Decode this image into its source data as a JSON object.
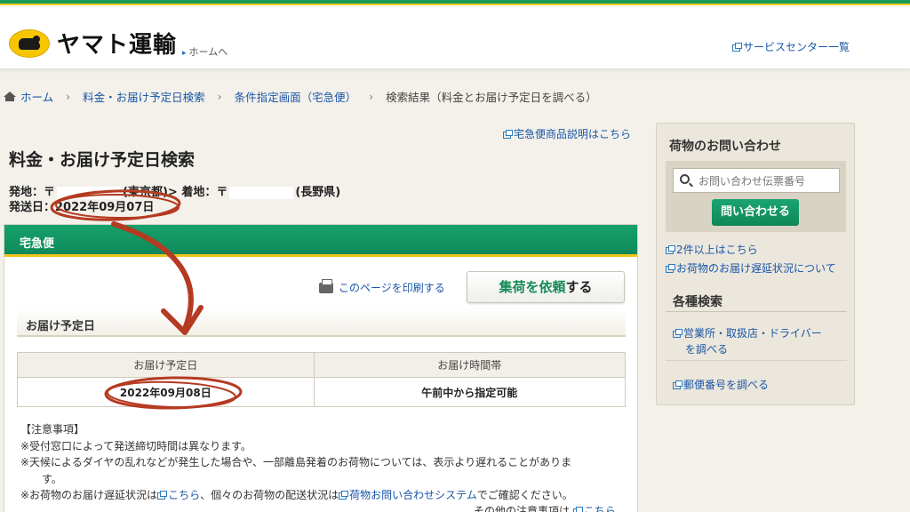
{
  "header": {
    "brand": "ヤマト運輸",
    "home_link": "ホームへ",
    "service_link": "サービスセンター一覧"
  },
  "breadcrumb": {
    "home": "ホーム",
    "item1": "料金・お届け予定日検索",
    "item2": "条件指定画面（宅急便）",
    "current": "検索結果（料金とお届け予定日を調べる）"
  },
  "main": {
    "product_link": "宅急便商品説明はこちら",
    "title": "料金・お届け予定日検索",
    "origin_label": "発地：〒",
    "origin_pref": "(東京都)",
    "dest_label": "> 着地：〒",
    "dest_pref": "(長野県)",
    "ship_date_label": "発送日：",
    "ship_date": "2022年09月07日"
  },
  "card": {
    "header": "宅急便",
    "print_link": "このページを印刷する",
    "pickup_button_hl": "集荷を依頼",
    "pickup_button_rest": "する",
    "section_title": "お届け予定日",
    "table": {
      "col1": "お届け予定日",
      "col2": "お届け時間帯",
      "val1": "2022年09月08日",
      "val2": "午前中から指定可能"
    },
    "notes_title": "【注意事項】",
    "note1": "※受付窓口によって発送締切時間は異なります。",
    "note2": "※天候によるダイヤの乱れなどが発生した場合や、一部離島発着のお荷物については、表示より遅れることがありま",
    "note2b": "す。",
    "note3a": "※お荷物のお届け遅延状況は",
    "note3_link1": "こちら",
    "note3b": "、個々のお荷物の配送状況は",
    "note3_link2": "荷物お問い合わせシステム",
    "note3c": "でご確認ください。",
    "more_prefix": "その他の注意事項は",
    "more_link": "こちら"
  },
  "sidebar": {
    "title": "荷物のお問い合わせ",
    "search_placeholder": "お問い合わせ伝票番号",
    "button": "問い合わせる",
    "link1": "2件以上はこちら",
    "link2": "お荷物のお届け遅延状況について",
    "title2": "各種検索",
    "link3a": "営業所・取扱店・ドライバー",
    "link3b": "を調べる",
    "link4": "郵便番号を調べる"
  },
  "colors": {
    "brand_green": "#0f8a5a",
    "accent_yellow": "#f2c51b",
    "annotation_red": "#b53a22",
    "link_blue": "#1b56a8"
  }
}
